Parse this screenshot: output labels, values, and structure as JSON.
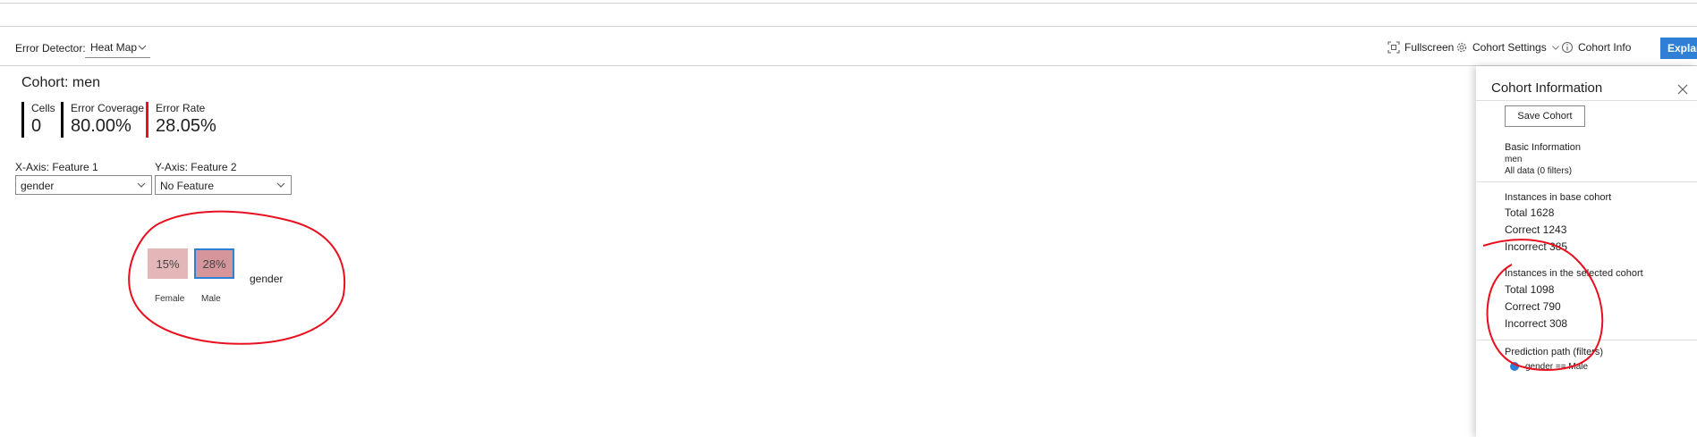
{
  "toolbar": {
    "detector_label": "Error Detector:",
    "detector_value": "Heat Map",
    "fullscreen": "Fullscreen",
    "cohort_settings": "Cohort Settings",
    "cohort_info": "Cohort Info",
    "explanation": "Explanation"
  },
  "cohort": {
    "title": "Cohort: men",
    "metrics": [
      {
        "label": "Cells",
        "value": "0"
      },
      {
        "label": "Error Coverage",
        "value": "80.00%"
      },
      {
        "label": "Error Rate",
        "value": "28.05%"
      }
    ]
  },
  "axes": {
    "x_label": "X-Axis: Feature 1",
    "x_value": "gender",
    "y_label": "Y-Axis: Feature 2",
    "y_value": "No Feature"
  },
  "heatmap": {
    "cells": [
      {
        "label": "Female",
        "value": "15%"
      },
      {
        "label": "Male",
        "value": "28%",
        "selected": true
      }
    ],
    "axis_label": "gender",
    "colors": {
      "female": "#e3b6b7",
      "male": "#d6959a",
      "selected_border": "#2f7fd6"
    }
  },
  "panel": {
    "title": "Cohort Information",
    "save_button": "Save Cohort",
    "basic_info_title": "Basic Information",
    "cohort_name": "men",
    "filters": "All data (0 filters)",
    "base_title": "Instances in base cohort",
    "base_total": "Total 1628",
    "base_correct": "Correct 1243",
    "base_incorrect": "Incorrect 385",
    "selected_title": "Instances in the selected cohort",
    "selected_total": "Total 1098",
    "selected_correct": "Correct 790",
    "selected_incorrect": "Incorrect 308",
    "path_title": "Prediction path (filters)",
    "path_item": "gender == Male"
  },
  "colors": {
    "accent": "#2f7fd6",
    "error": "#e81123",
    "annotation": "#e8101e"
  }
}
